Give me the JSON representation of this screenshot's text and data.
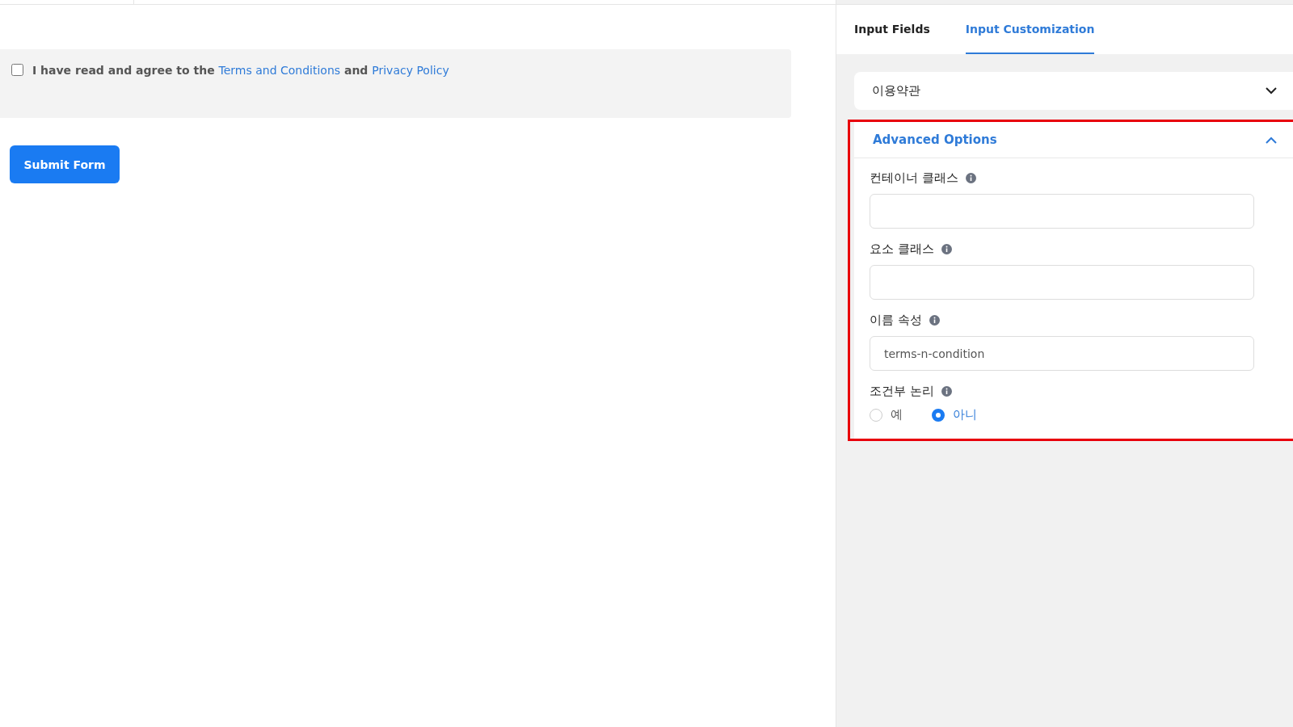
{
  "consent": {
    "checked": false,
    "prefix": "I have read and agree to the",
    "link_1": "Terms and Conditions",
    "middle": "and",
    "link_2": "Privacy Policy"
  },
  "submit_button": "Submit Form",
  "tabs": [
    {
      "label": "Input Fields",
      "selected": false
    },
    {
      "label": "Input Customization",
      "selected": true
    }
  ],
  "field_dropdown": {
    "value": "이용약관",
    "expanded": false
  },
  "advanced_options": {
    "title": "Advanced Options",
    "expanded": true,
    "highlighted": true,
    "fields": [
      {
        "kind": "text",
        "label": "컨테이너 클래스"
      },
      {
        "kind": "text",
        "label": "요소 클래스"
      },
      {
        "kind": "text",
        "label": "이름 속성",
        "value": "terms-n-condition"
      },
      {
        "kind": "radio",
        "label": "조건부 논리",
        "options": [
          {
            "label": "예",
            "selected": false
          },
          {
            "label": "아니",
            "selected": true
          }
        ]
      }
    ]
  }
}
